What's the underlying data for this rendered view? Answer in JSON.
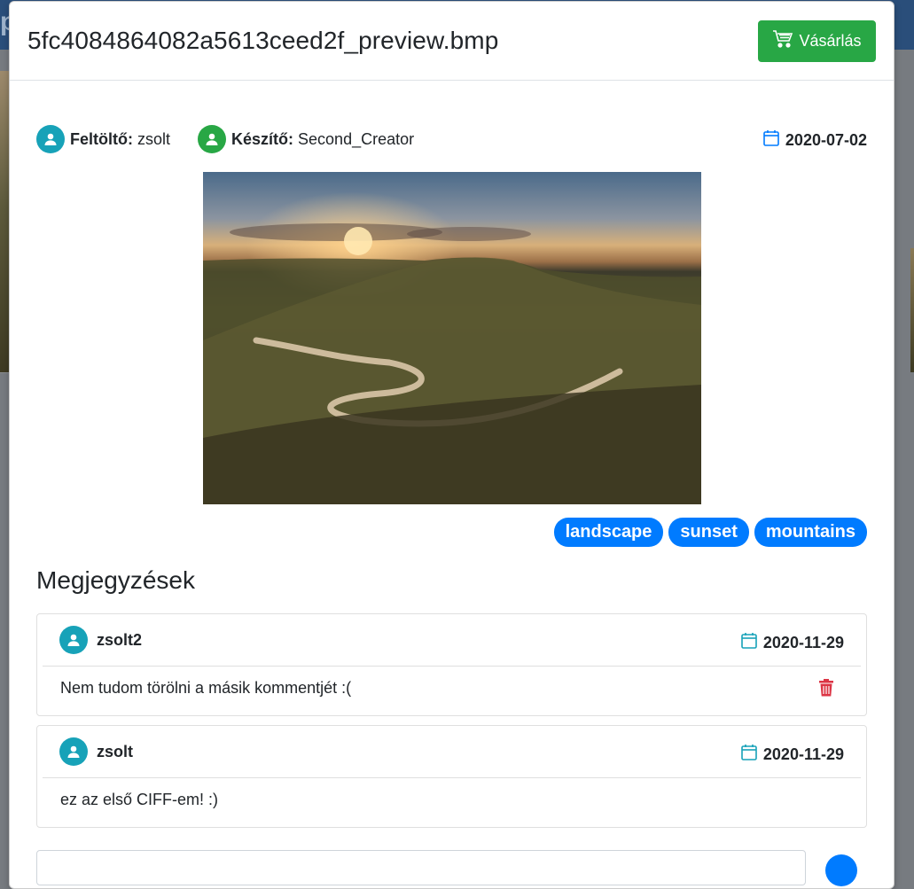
{
  "background": {
    "nav_letter": "p"
  },
  "modal": {
    "title": "5fc4084864082a5613ceed2f_preview.bmp",
    "buy_label": "Vásárlás"
  },
  "meta": {
    "uploader_label": "Feltöltő:",
    "uploader": "zsolt",
    "creator_label": "Készítő:",
    "creator": "Second_Creator",
    "date": "2020-07-02"
  },
  "tags": [
    "landscape",
    "sunset",
    "mountains"
  ],
  "comments_title": "Megjegyzések",
  "comments": [
    {
      "author": "zsolt2",
      "date": "2020-11-29",
      "text": "Nem tudom törölni a másik kommentjét :("
    },
    {
      "author": "zsolt",
      "date": "2020-11-29",
      "text": "ez az első CIFF-em! :)"
    }
  ],
  "colors": {
    "success": "#28a745",
    "primary": "#007bff",
    "info": "#17a2b8",
    "danger": "#dc3545"
  },
  "icons": [
    "cart-icon",
    "user-icon",
    "calendar-icon",
    "trash-icon",
    "send-icon"
  ]
}
